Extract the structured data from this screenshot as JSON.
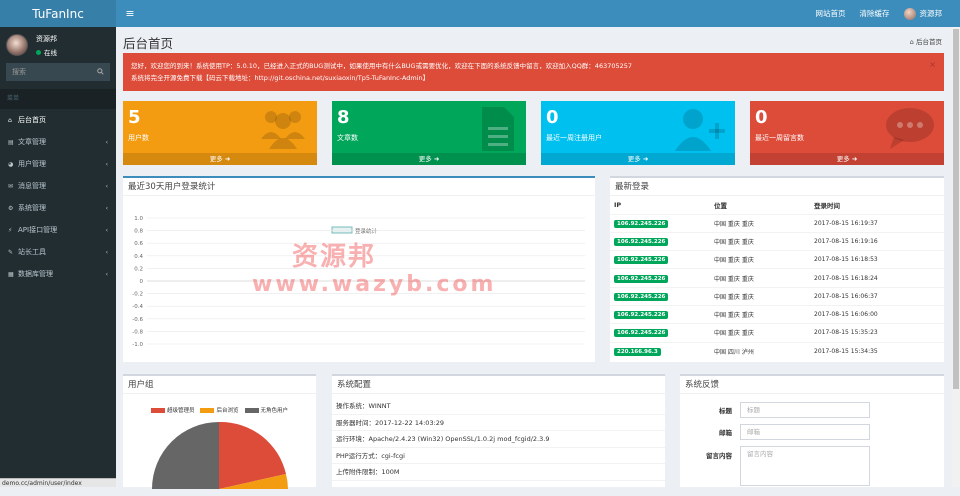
{
  "app": {
    "logo": "TuFanInc"
  },
  "topbar": {
    "toggle_icon": "hamburger-icon",
    "site_home": "网站首页",
    "clear_cache": "清除缓存",
    "user_name": "资源邦"
  },
  "sidebar": {
    "user_name": "资源邦",
    "status": "在线",
    "search_placeholder": "搜索",
    "section_header": "菜单",
    "items": [
      {
        "label": "后台首页",
        "icon": "home-icon",
        "chevron": ""
      },
      {
        "label": "文章管理",
        "icon": "file-icon",
        "chevron": "‹"
      },
      {
        "label": "用户管理",
        "icon": "users-icon",
        "chevron": "‹"
      },
      {
        "label": "消息管理",
        "icon": "message-icon",
        "chevron": "‹"
      },
      {
        "label": "系统管理",
        "icon": "gear-icon",
        "chevron": "‹"
      },
      {
        "label": "API接口管理",
        "icon": "api-icon",
        "chevron": "‹"
      },
      {
        "label": "站长工具",
        "icon": "wrench-icon",
        "chevron": "‹"
      },
      {
        "label": "数据库管理",
        "icon": "database-icon",
        "chevron": "‹"
      }
    ]
  },
  "page": {
    "title": "后台首页",
    "breadcrumb": "后台首页"
  },
  "alert": {
    "line1": "您好，欢迎您的到来！系统使用TP：5.0.10，已经进入正式的BUG测试中，如果使用中有什么BUG或需要优化，欢迎在下面的系统反馈中留言，欢迎加入QQ群：463705257",
    "line2": "系统将完全开源免费下载【码云下载地址：http://git.oschina.net/suxiaoxin/Tp5-TuFanInc-Admin】",
    "close": "×"
  },
  "stats": [
    {
      "value": "5",
      "label": "用户数",
      "more": "更多",
      "color": "#f39c12",
      "icon": "users-icon"
    },
    {
      "value": "8",
      "label": "文章数",
      "more": "更多",
      "color": "#00a65a",
      "icon": "file-icon"
    },
    {
      "value": "0",
      "label": "最近一周注册用户",
      "more": "更多",
      "color": "#00c0ef",
      "icon": "user-add-icon"
    },
    {
      "value": "0",
      "label": "最近一周留言数",
      "more": "更多",
      "color": "#dd4b39",
      "icon": "chat-icon"
    }
  ],
  "chart_panel": {
    "title": "最近30天用户登录统计"
  },
  "chart_data": {
    "type": "line",
    "series": [
      {
        "name": "登录统计",
        "values": []
      }
    ],
    "yticks": [
      "1.0",
      "0.8",
      "0.6",
      "0.4",
      "0.2",
      "0",
      "-0.2",
      "-0.4",
      "-0.6",
      "-0.8",
      "-1.0"
    ],
    "ylim": [
      -1.0,
      1.0
    ],
    "grid": true,
    "legend": "top-center"
  },
  "logins": {
    "title": "最新登录",
    "headers": [
      "IP",
      "位置",
      "登录时间"
    ],
    "rows": [
      {
        "ip": "106.92.245.226",
        "loc": "中国 重庆 重庆",
        "time": "2017-08-15 16:19:37"
      },
      {
        "ip": "106.92.245.226",
        "loc": "中国 重庆 重庆",
        "time": "2017-08-15 16:19:16"
      },
      {
        "ip": "106.92.245.226",
        "loc": "中国 重庆 重庆",
        "time": "2017-08-15 16:18:53"
      },
      {
        "ip": "106.92.245.226",
        "loc": "中国 重庆 重庆",
        "time": "2017-08-15 16:18:24"
      },
      {
        "ip": "106.92.245.226",
        "loc": "中国 重庆 重庆",
        "time": "2017-08-15 16:06:37"
      },
      {
        "ip": "106.92.245.226",
        "loc": "中国 重庆 重庆",
        "time": "2017-08-15 16:06:00"
      },
      {
        "ip": "106.92.245.226",
        "loc": "中国 重庆 重庆",
        "time": "2017-08-15 15:35:23"
      },
      {
        "ip": "220.166.96.3",
        "loc": "中国 四川 泸州",
        "time": "2017-08-15 15:34:35"
      }
    ]
  },
  "usergroup": {
    "title": "用户组",
    "legend": [
      {
        "name": "超级管理员",
        "color": "#dd4b39"
      },
      {
        "name": "后台浏览",
        "color": "#f39c12"
      },
      {
        "name": "无角色用户",
        "color": "#666666"
      }
    ]
  },
  "sysconfig": {
    "title": "系统配置",
    "rows": [
      "操作系统：WINNT",
      "服务器时间：2017-12-22 14:03:29",
      "运行环境：Apache/2.4.23 (Win32) OpenSSL/1.0.2j mod_fcgid/2.3.9",
      "PHP运行方式：cgi-fcgi",
      "上传附件限制：100M"
    ]
  },
  "feedback": {
    "title": "系统反馈",
    "title_label": "标题",
    "title_placeholder": "标题",
    "email_label": "邮箱",
    "email_placeholder": "邮箱",
    "content_label": "留言内容",
    "content_placeholder": "留言内容"
  },
  "statusbar": {
    "url": "demo.cc/admin/user/index"
  },
  "watermark": {
    "line1": "资源邦",
    "line2": "www.wazyb.com"
  }
}
